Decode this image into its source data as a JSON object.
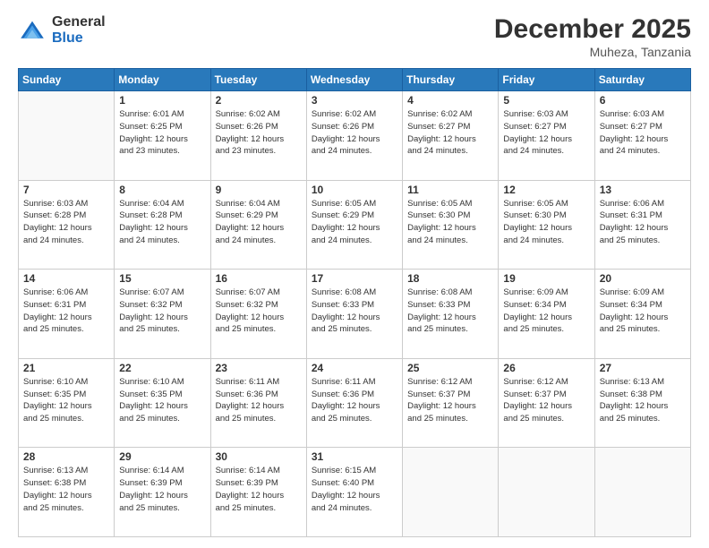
{
  "header": {
    "logo_general": "General",
    "logo_blue": "Blue",
    "month_title": "December 2025",
    "location": "Muheza, Tanzania"
  },
  "weekdays": [
    "Sunday",
    "Monday",
    "Tuesday",
    "Wednesday",
    "Thursday",
    "Friday",
    "Saturday"
  ],
  "weeks": [
    [
      {
        "day": "",
        "info": ""
      },
      {
        "day": "1",
        "info": "Sunrise: 6:01 AM\nSunset: 6:25 PM\nDaylight: 12 hours\nand 23 minutes."
      },
      {
        "day": "2",
        "info": "Sunrise: 6:02 AM\nSunset: 6:26 PM\nDaylight: 12 hours\nand 23 minutes."
      },
      {
        "day": "3",
        "info": "Sunrise: 6:02 AM\nSunset: 6:26 PM\nDaylight: 12 hours\nand 24 minutes."
      },
      {
        "day": "4",
        "info": "Sunrise: 6:02 AM\nSunset: 6:27 PM\nDaylight: 12 hours\nand 24 minutes."
      },
      {
        "day": "5",
        "info": "Sunrise: 6:03 AM\nSunset: 6:27 PM\nDaylight: 12 hours\nand 24 minutes."
      },
      {
        "day": "6",
        "info": "Sunrise: 6:03 AM\nSunset: 6:27 PM\nDaylight: 12 hours\nand 24 minutes."
      }
    ],
    [
      {
        "day": "7",
        "info": "Sunrise: 6:03 AM\nSunset: 6:28 PM\nDaylight: 12 hours\nand 24 minutes."
      },
      {
        "day": "8",
        "info": "Sunrise: 6:04 AM\nSunset: 6:28 PM\nDaylight: 12 hours\nand 24 minutes."
      },
      {
        "day": "9",
        "info": "Sunrise: 6:04 AM\nSunset: 6:29 PM\nDaylight: 12 hours\nand 24 minutes."
      },
      {
        "day": "10",
        "info": "Sunrise: 6:05 AM\nSunset: 6:29 PM\nDaylight: 12 hours\nand 24 minutes."
      },
      {
        "day": "11",
        "info": "Sunrise: 6:05 AM\nSunset: 6:30 PM\nDaylight: 12 hours\nand 24 minutes."
      },
      {
        "day": "12",
        "info": "Sunrise: 6:05 AM\nSunset: 6:30 PM\nDaylight: 12 hours\nand 24 minutes."
      },
      {
        "day": "13",
        "info": "Sunrise: 6:06 AM\nSunset: 6:31 PM\nDaylight: 12 hours\nand 25 minutes."
      }
    ],
    [
      {
        "day": "14",
        "info": "Sunrise: 6:06 AM\nSunset: 6:31 PM\nDaylight: 12 hours\nand 25 minutes."
      },
      {
        "day": "15",
        "info": "Sunrise: 6:07 AM\nSunset: 6:32 PM\nDaylight: 12 hours\nand 25 minutes."
      },
      {
        "day": "16",
        "info": "Sunrise: 6:07 AM\nSunset: 6:32 PM\nDaylight: 12 hours\nand 25 minutes."
      },
      {
        "day": "17",
        "info": "Sunrise: 6:08 AM\nSunset: 6:33 PM\nDaylight: 12 hours\nand 25 minutes."
      },
      {
        "day": "18",
        "info": "Sunrise: 6:08 AM\nSunset: 6:33 PM\nDaylight: 12 hours\nand 25 minutes."
      },
      {
        "day": "19",
        "info": "Sunrise: 6:09 AM\nSunset: 6:34 PM\nDaylight: 12 hours\nand 25 minutes."
      },
      {
        "day": "20",
        "info": "Sunrise: 6:09 AM\nSunset: 6:34 PM\nDaylight: 12 hours\nand 25 minutes."
      }
    ],
    [
      {
        "day": "21",
        "info": "Sunrise: 6:10 AM\nSunset: 6:35 PM\nDaylight: 12 hours\nand 25 minutes."
      },
      {
        "day": "22",
        "info": "Sunrise: 6:10 AM\nSunset: 6:35 PM\nDaylight: 12 hours\nand 25 minutes."
      },
      {
        "day": "23",
        "info": "Sunrise: 6:11 AM\nSunset: 6:36 PM\nDaylight: 12 hours\nand 25 minutes."
      },
      {
        "day": "24",
        "info": "Sunrise: 6:11 AM\nSunset: 6:36 PM\nDaylight: 12 hours\nand 25 minutes."
      },
      {
        "day": "25",
        "info": "Sunrise: 6:12 AM\nSunset: 6:37 PM\nDaylight: 12 hours\nand 25 minutes."
      },
      {
        "day": "26",
        "info": "Sunrise: 6:12 AM\nSunset: 6:37 PM\nDaylight: 12 hours\nand 25 minutes."
      },
      {
        "day": "27",
        "info": "Sunrise: 6:13 AM\nSunset: 6:38 PM\nDaylight: 12 hours\nand 25 minutes."
      }
    ],
    [
      {
        "day": "28",
        "info": "Sunrise: 6:13 AM\nSunset: 6:38 PM\nDaylight: 12 hours\nand 25 minutes."
      },
      {
        "day": "29",
        "info": "Sunrise: 6:14 AM\nSunset: 6:39 PM\nDaylight: 12 hours\nand 25 minutes."
      },
      {
        "day": "30",
        "info": "Sunrise: 6:14 AM\nSunset: 6:39 PM\nDaylight: 12 hours\nand 25 minutes."
      },
      {
        "day": "31",
        "info": "Sunrise: 6:15 AM\nSunset: 6:40 PM\nDaylight: 12 hours\nand 24 minutes."
      },
      {
        "day": "",
        "info": ""
      },
      {
        "day": "",
        "info": ""
      },
      {
        "day": "",
        "info": ""
      }
    ]
  ]
}
